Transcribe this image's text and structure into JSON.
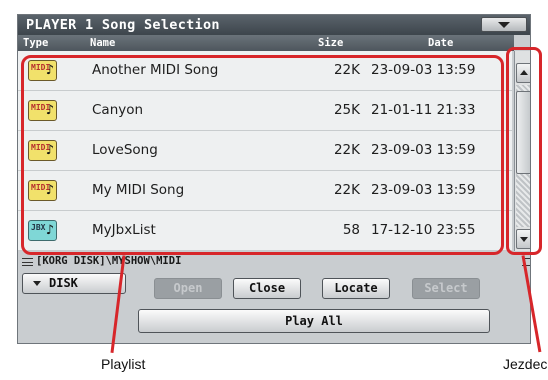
{
  "window": {
    "title": "PLAYER 1 Song Selection"
  },
  "columns": {
    "type": "Type",
    "name": "Name",
    "size": "Size",
    "date": "Date"
  },
  "songs": [
    {
      "icon_label": "MIDI",
      "icon_kind": "midi-file-icon",
      "name": "Another MIDI Song",
      "size": "22K",
      "date": "23-09-03 13:59"
    },
    {
      "icon_label": "MIDI",
      "icon_kind": "midi-file-icon",
      "name": "Canyon",
      "size": "25K",
      "date": "21-01-11 21:33"
    },
    {
      "icon_label": "MIDI",
      "icon_kind": "midi-file-icon",
      "name": "LoveSong",
      "size": "22K",
      "date": "23-09-03 13:59"
    },
    {
      "icon_label": "MIDI",
      "icon_kind": "midi-file-icon",
      "name": "My MIDI Song",
      "size": "22K",
      "date": "23-09-03 13:59"
    },
    {
      "icon_label": "JBX",
      "icon_kind": "jukebox-file-icon",
      "name": "MyJbxList",
      "size": "58",
      "date": "17-12-10 23:55"
    }
  ],
  "icon_note_glyph": "♪",
  "scrollbar": {
    "thumb_start": 0.04,
    "thumb_fraction": 0.59
  },
  "path": "[KORG DISK]\\MYSHOW\\MIDI",
  "buttons": {
    "disk": "DISK",
    "open": "Open",
    "close": "Close",
    "locate": "Locate",
    "select": "Select",
    "play_all": "Play All"
  },
  "annotations": {
    "playlist": "Playlist",
    "scrollbar": "Jezdec"
  },
  "colors": {
    "highlight": "#d7262a",
    "title_bar": "#4a535a",
    "midi_icon": "#f1e16b",
    "jbx_icon": "#7fd7d6"
  }
}
